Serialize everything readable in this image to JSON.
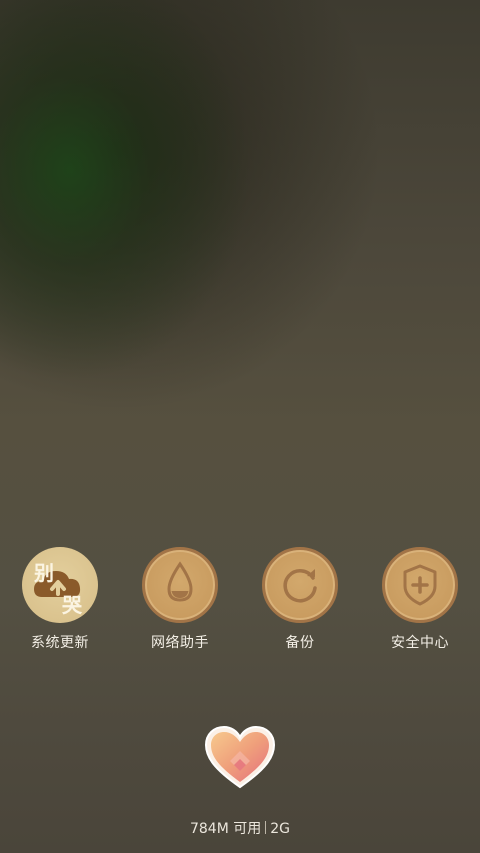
{
  "dock": {
    "items": [
      {
        "label": "系统更新",
        "icon": "cloud-upload-icon",
        "decoration": [
          "别",
          "哭"
        ]
      },
      {
        "label": "网络助手",
        "icon": "water-drop-icon"
      },
      {
        "label": "备份",
        "icon": "refresh-arrow-icon"
      },
      {
        "label": "安全中心",
        "icon": "shield-plus-icon"
      }
    ]
  },
  "memory": {
    "available": "784M 可用",
    "total": "2G"
  },
  "colors": {
    "icon_gold": "#c99c60",
    "icon_border": "#a27447",
    "update_icon_bg": "#d9c18c",
    "label_text": "#f3efe6"
  }
}
